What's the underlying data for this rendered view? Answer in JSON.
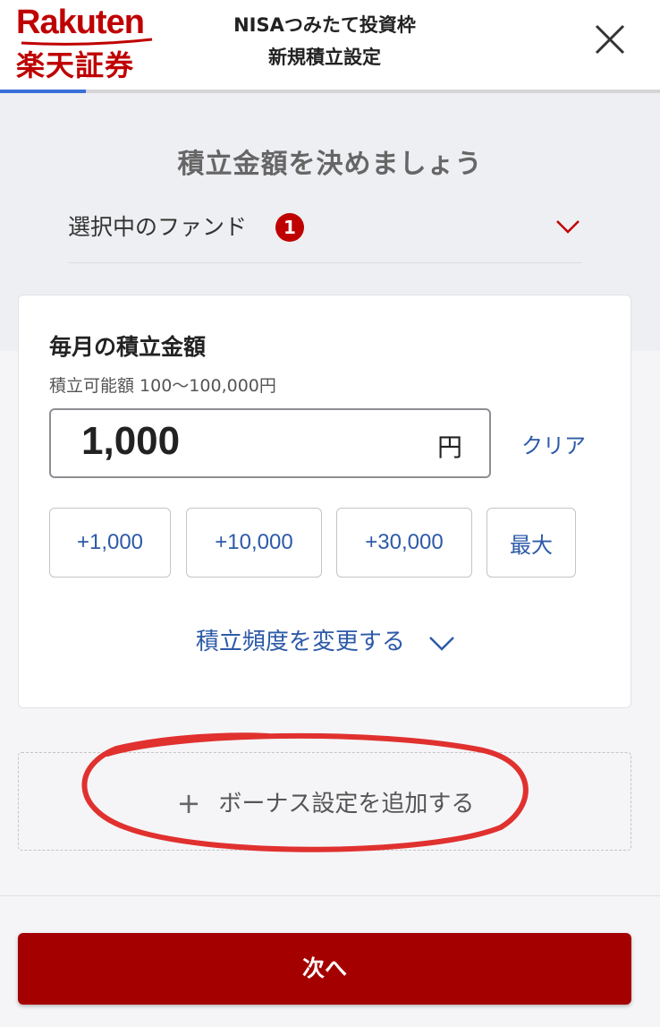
{
  "header": {
    "logo_en": "Rakuten",
    "logo_ja": "楽天証券",
    "title_line1": "NISAつみたて投資枠",
    "title_line2": "新規積立設定",
    "close_icon": "close-icon"
  },
  "progress": {
    "fraction": 0.13,
    "color": "#3a6fd8"
  },
  "section": {
    "heading": "積立金額を決めましょう"
  },
  "fund": {
    "label": "選択中のファンド",
    "count": "1",
    "badge_color": "#bf0000"
  },
  "amount_card": {
    "title": "毎月の積立金額",
    "range": "積立可能額 100〜100,000円",
    "value": "1,000",
    "unit": "円",
    "clear_label": "クリア",
    "quick_buttons": [
      "+1,000",
      "+10,000",
      "+30,000",
      "最大"
    ],
    "frequency_link": "積立頻度を変更する"
  },
  "bonus": {
    "label": "ボーナス設定を追加する",
    "plus_icon": "plus-icon"
  },
  "footer": {
    "next_label": "次へ",
    "button_color": "#a50000"
  },
  "colors": {
    "brand": "#bf0000",
    "link": "#2d5aa8",
    "annotation": "#e0312f"
  }
}
